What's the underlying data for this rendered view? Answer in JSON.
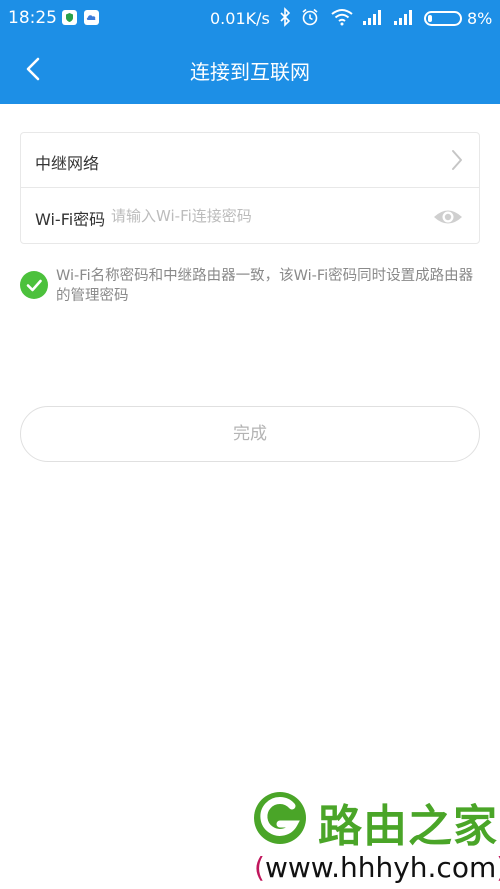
{
  "status_bar": {
    "time": "18:25",
    "speed": "0.01K/s",
    "battery": "8%",
    "icons": [
      "shield-icon",
      "cloud-icon",
      "bluetooth-icon",
      "alarm-icon",
      "wifi-icon",
      "signal-icon",
      "signal-icon",
      "battery-icon"
    ]
  },
  "header": {
    "title": "连接到互联网",
    "back_icon": "back-arrow-icon"
  },
  "form": {
    "relay_network_label": "中继网络",
    "wifi_password_label": "Wi-Fi密码",
    "wifi_password_placeholder": "请输入Wi-Fi连接密码",
    "wifi_password_value": ""
  },
  "note": {
    "checked": true,
    "text": "Wi-Fi名称密码和中继路由器一致，该Wi-Fi密码同时设置成路由器的管理密码"
  },
  "done_button_label": "完成",
  "watermark": {
    "name": "路由之家",
    "url_open": "(",
    "url": "www.hhhyh.com",
    "url_close": ")"
  },
  "colors": {
    "primary": "#1d8fe6",
    "check": "#4cc13c",
    "watermark_green": "#4aa528",
    "watermark_paren": "#c0165c"
  }
}
